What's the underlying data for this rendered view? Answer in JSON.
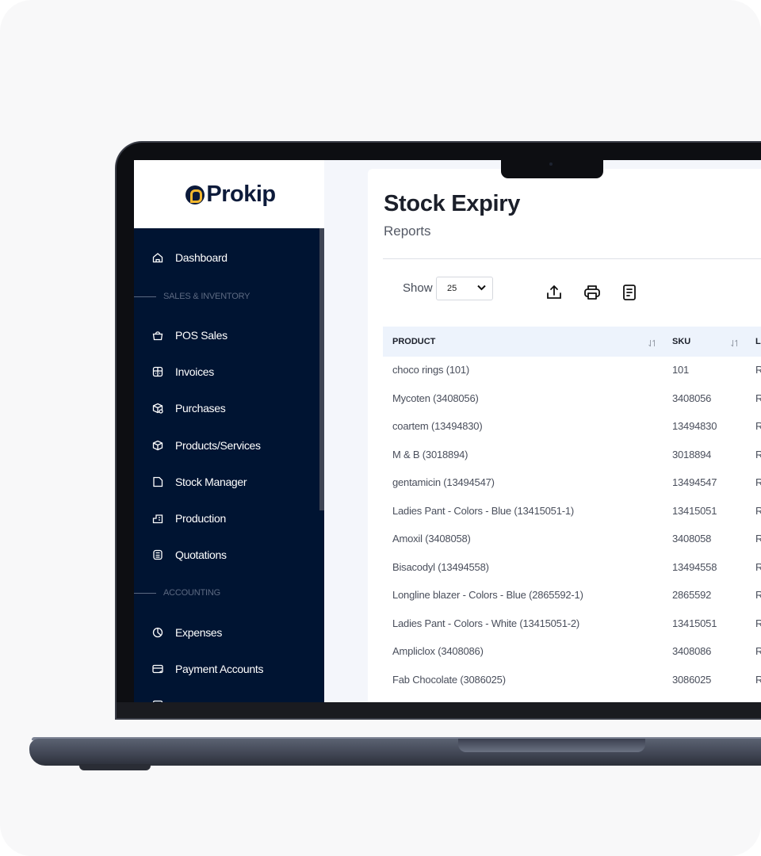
{
  "app": {
    "brand": "Prokip"
  },
  "sidebar": {
    "items": [
      {
        "label": "Dashboard",
        "icon": "home-icon"
      },
      {
        "section": "SALES & INVENTORY"
      },
      {
        "label": "POS Sales",
        "icon": "shopping-bag-icon"
      },
      {
        "label": "Invoices",
        "icon": "invoice-icon"
      },
      {
        "label": "Purchases",
        "icon": "purchase-box-icon"
      },
      {
        "label": "Products/Services",
        "icon": "package-icon"
      },
      {
        "label": "Stock Manager",
        "icon": "folder-icon"
      },
      {
        "label": "Production",
        "icon": "factory-icon"
      },
      {
        "label": "Quotations",
        "icon": "calculator-icon"
      },
      {
        "section": "ACCOUNTING"
      },
      {
        "label": "Expenses",
        "icon": "pie-chart-icon"
      },
      {
        "label": "Payment Accounts",
        "icon": "card-icon"
      }
    ]
  },
  "page": {
    "title": "Stock Expiry",
    "subtitle": "Reports"
  },
  "toolbar": {
    "show_label": "Show",
    "page_size": "25",
    "icons": [
      "export-icon",
      "print-icon",
      "document-icon"
    ]
  },
  "table": {
    "columns": [
      "PRODUCT",
      "SKU",
      "LO"
    ],
    "rows": [
      {
        "product": "choco rings (101)",
        "sku": "101",
        "loc": "R"
      },
      {
        "product": "Mycoten (3408056)",
        "sku": "3408056",
        "loc": "R"
      },
      {
        "product": "coartem (13494830)",
        "sku": "13494830",
        "loc": "R"
      },
      {
        "product": "M & B (3018894)",
        "sku": "3018894",
        "loc": "R"
      },
      {
        "product": "gentamicin (13494547)",
        "sku": "13494547",
        "loc": "R"
      },
      {
        "product": "Ladies Pant - Colors - Blue (13415051-1)",
        "sku": "13415051",
        "loc": "R"
      },
      {
        "product": "Amoxil (3408058)",
        "sku": "3408058",
        "loc": "R"
      },
      {
        "product": "Bisacodyl (13494558)",
        "sku": "13494558",
        "loc": "R"
      },
      {
        "product": "Longline blazer - Colors - Blue (2865592-1)",
        "sku": "2865592",
        "loc": "R"
      },
      {
        "product": "Ladies Pant - Colors - White (13415051-2)",
        "sku": "13415051",
        "loc": "R"
      },
      {
        "product": "Ampliclox (3408086)",
        "sku": "3408086",
        "loc": "R"
      },
      {
        "product": "Fab Chocolate (3086025)",
        "sku": "3086025",
        "loc": "R"
      }
    ]
  },
  "colors": {
    "sidebar_bg": "#001432",
    "logo_accent": "#f5b82e",
    "table_header_bg": "#edf3fc"
  }
}
